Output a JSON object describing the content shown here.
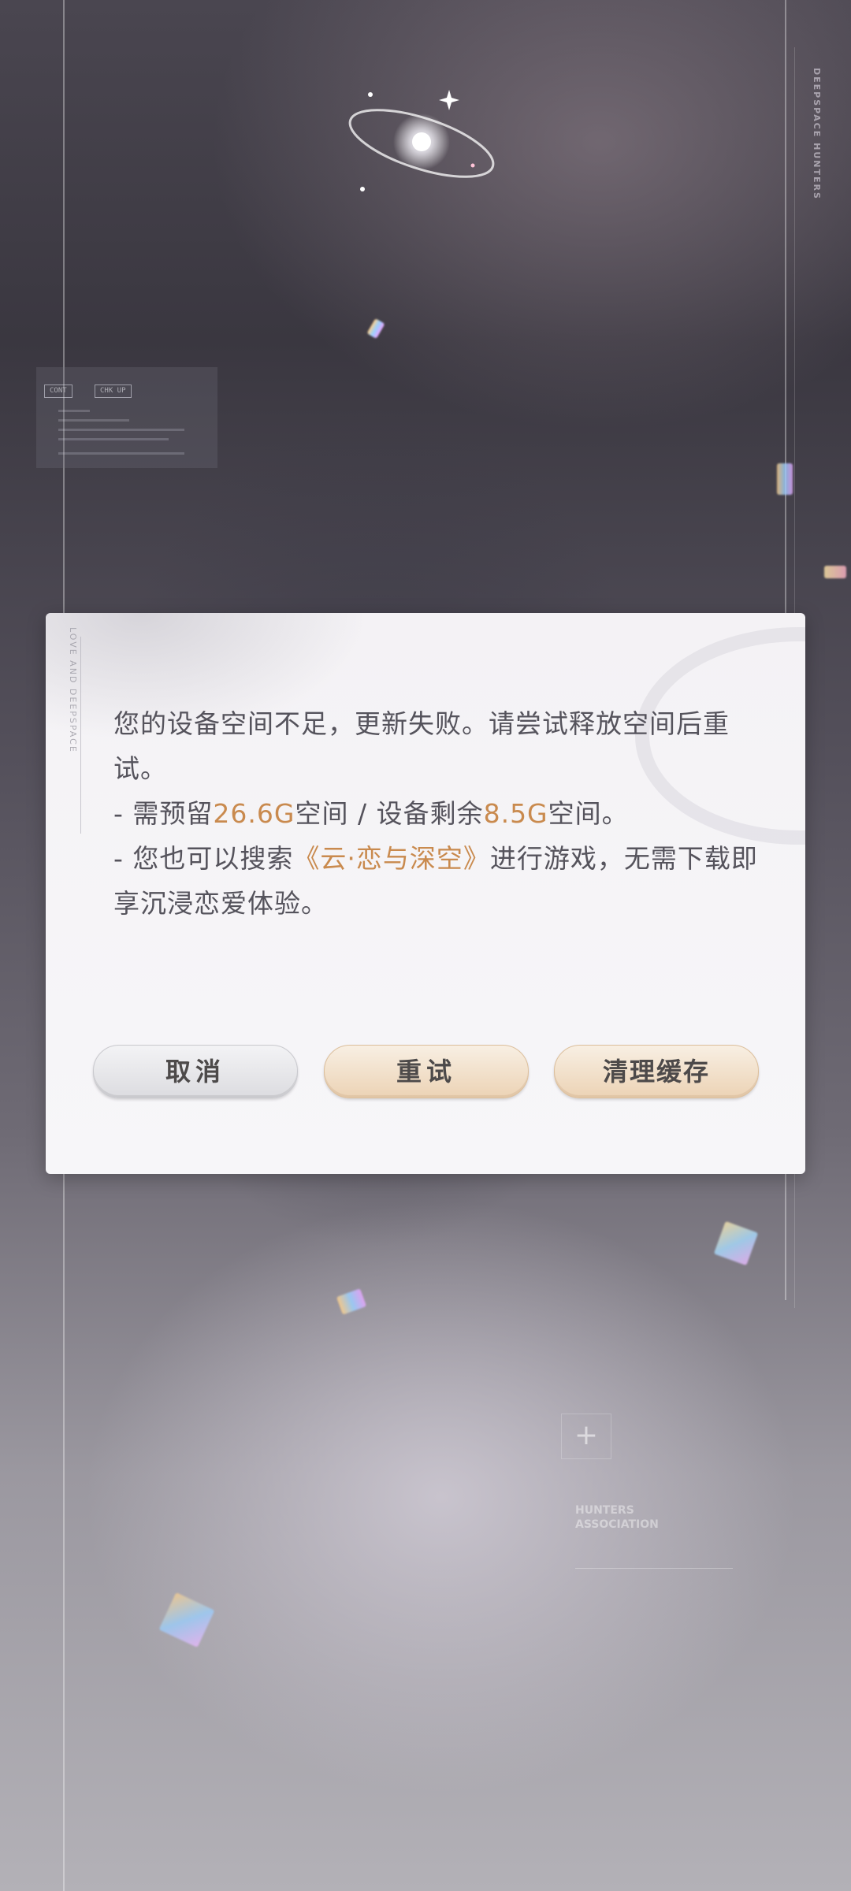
{
  "background": {
    "brand_vertical_text": "DEEPSPACE HUNTERS",
    "hud_chip_1": "CONT",
    "hud_chip_2": "CHK UP",
    "association_text": "HUNTERS ASSOCIATION",
    "plus_symbol": "+"
  },
  "dialog": {
    "vertical_tag": "LOVE AND DEEPSPACE",
    "message": {
      "line1": "您的设备空间不足，更新失败。请尝试释放空间后重试。",
      "line2_prefix": "- 需预留",
      "line2_required": "26.6G",
      "line2_middle": "空间 / 设备剩余",
      "line2_remaining": "8.5G",
      "line2_suffix": "空间。",
      "line3_prefix": "- 您也可以搜索",
      "line3_highlight": "《云·恋与深空》",
      "line3_suffix": "进行游戏，无需下载即享沉浸恋爱体验。"
    },
    "buttons": {
      "cancel": "取消",
      "retry": "重试",
      "clear_cache": "清理缓存"
    },
    "colors": {
      "highlight": "#c98a4e",
      "text": "#55535c"
    }
  }
}
